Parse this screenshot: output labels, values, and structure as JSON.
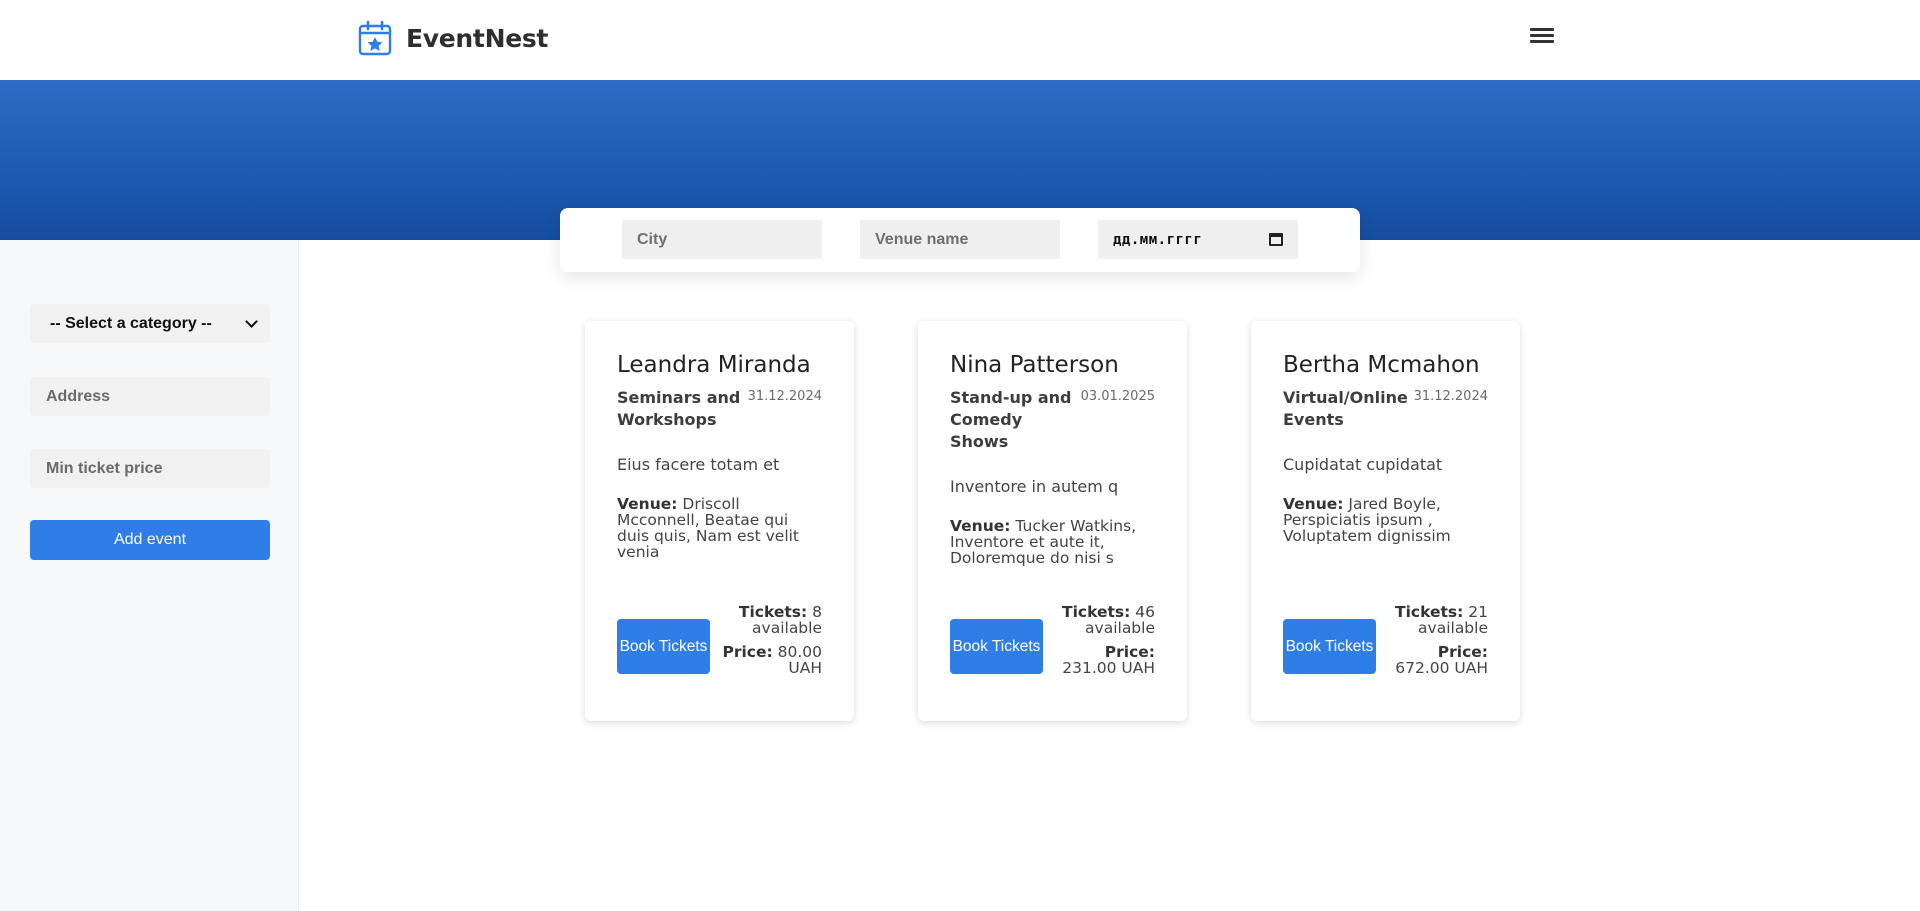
{
  "header": {
    "brand_name": "EventNest",
    "logo_icon": "calendar-star-icon",
    "menu_icon": "hamburger-menu-icon"
  },
  "colors": {
    "accent": "#2f7de6",
    "hero_top": "#2d6cc6",
    "hero_bottom": "#154d9f"
  },
  "search": {
    "city_placeholder": "City",
    "venue_placeholder": "Venue name",
    "date_placeholder": "дд.мм.гггг"
  },
  "sidebar": {
    "category_select": "-- Select a category --",
    "address_placeholder": "Address",
    "min_price_placeholder": "Min ticket price",
    "add_event_label": "Add event"
  },
  "labels": {
    "venue": "Venue:",
    "tickets": "Tickets:",
    "price": "Price:",
    "book": "Book Tickets"
  },
  "events": [
    {
      "name": "Leandra Miranda",
      "category": "Seminars and Workshops",
      "date": "31.12.2024",
      "description": "Eius facere totam et",
      "venue": "Driscoll Mcconnell, Beatae qui duis quis, Nam est velit venia",
      "tickets": "8 available",
      "price": "80.00 UAH"
    },
    {
      "name": "Nina Patterson",
      "category": "Stand-up and Comedy Shows",
      "date": "03.01.2025",
      "description": "Inventore in autem q",
      "venue": "Tucker Watkins, Inventore et aute it, Doloremque do nisi s",
      "tickets": "46 available",
      "price": "231.00 UAH"
    },
    {
      "name": "Bertha Mcmahon",
      "category": "Virtual/Online Events",
      "date": "31.12.2024",
      "description": "Cupidatat cupidatat",
      "venue": "Jared Boyle, Perspiciatis ipsum , Voluptatem dignissim",
      "tickets": "21 available",
      "price": "672.00 UAH"
    }
  ]
}
